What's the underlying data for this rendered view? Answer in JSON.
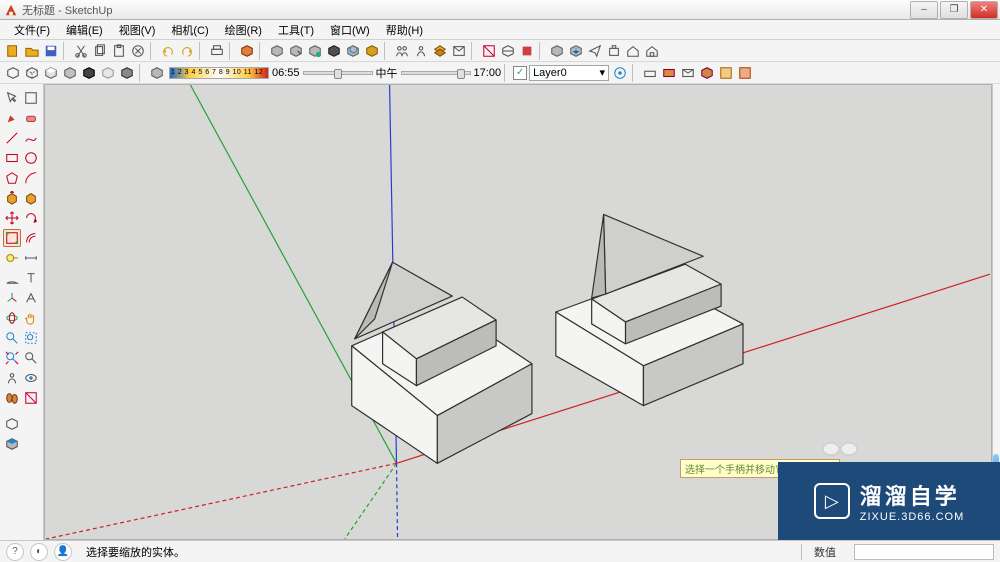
{
  "window": {
    "title": "无标题 - SketchUp",
    "min": "–",
    "max": "❐",
    "close": "✕"
  },
  "menu": {
    "file": "文件(F)",
    "edit": "编辑(E)",
    "view": "视图(V)",
    "camera": "相机(C)",
    "draw": "绘图(R)",
    "tools": "工具(T)",
    "window": "窗口(W)",
    "help": "帮助(H)"
  },
  "time": {
    "scale": "1 2 3 4 5 6 7 8 9 10 11 12",
    "t1": "06:55",
    "mid": "中午",
    "t2": "17:00"
  },
  "layer": {
    "check": "✓",
    "current": "Layer0",
    "caret": "▾"
  },
  "tooltip": "选择一个手柄并移动它以调整比例",
  "status": {
    "help": "?",
    "lamp": "◐",
    "user": "👤",
    "hint": "选择要缩放的实体。",
    "vcb_label": "数值"
  },
  "watermark": {
    "brand": "溜溜自学",
    "url": "ZIXUE.3D66.COM",
    "play": "▷"
  }
}
